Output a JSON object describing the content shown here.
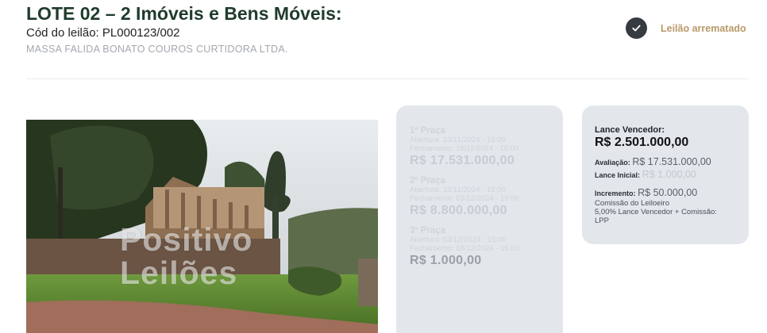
{
  "header": {
    "title": "LOTE 02 – 2 Imóveis e Bens Móveis:",
    "code_label": "Cód do leilão:",
    "code_value": "PL000123/002",
    "company": "MASSA FALIDA BONATO COUROS CURTIDORA LTDA."
  },
  "status": {
    "label": "Leilão arrematado",
    "icon": "check-icon"
  },
  "photo": {
    "watermark_line1": "Positivo",
    "watermark_line2": "Leilões"
  },
  "pracas": [
    {
      "label": "1º Praça",
      "abertura": "Abertura: 13/11/2024 - 15:00",
      "fechamento": "Fechamento: 18/11/2024 - 15:00",
      "value": "R$ 17.531.000,00"
    },
    {
      "label": "2º Praça",
      "abertura": "Abertura: 18/11/2024 - 15:00",
      "fechamento": "Fechamento: 03/12/2024 - 15:00",
      "value": "R$ 8.800.000,00"
    },
    {
      "label": "3º Praça",
      "abertura": "Abertura: 03/12/2024 - 15:00",
      "fechamento": "Fechamento: 18/12/2024 - 15:00",
      "value": "R$ 1.000,00"
    }
  ],
  "bid": {
    "winner_label": "Lance Vencedor:",
    "winner_value": "R$ 2.501.000,00",
    "avaliacao_label": "Avaliação:",
    "avaliacao_value": "R$ 17.531.000,00",
    "inicial_label": "Lance Inicial:",
    "inicial_value": "R$ 1.000,00",
    "incremento_label": "Incremento:",
    "incremento_value": "R$ 50.000,00",
    "comissao_line1": "Comissão do Leiloeiro",
    "comissao_line2": "5,00% Lance Vencedor + Comissão:",
    "comissao_line3": "LPP"
  },
  "colors": {
    "title": "#1f3b2c",
    "status": "#b89a6a",
    "card": "#e3e7ec",
    "check_circle": "#363b41"
  }
}
